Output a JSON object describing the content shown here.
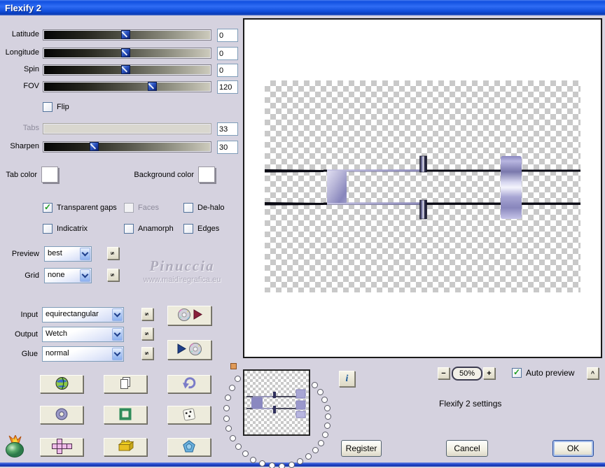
{
  "window": {
    "title": "Flexify 2"
  },
  "sliders": {
    "latitude": {
      "label": "Latitude",
      "value": "0",
      "position_pct": 49
    },
    "longitude": {
      "label": "Longitude",
      "value": "0",
      "position_pct": 49
    },
    "spin": {
      "label": "Spin",
      "value": "0",
      "position_pct": 49
    },
    "fov": {
      "label": "FOV",
      "value": "120",
      "position_pct": 65
    },
    "tabs": {
      "label": "Tabs",
      "value": "33",
      "disabled": true
    },
    "sharpen": {
      "label": "Sharpen",
      "value": "30",
      "position_pct": 30
    }
  },
  "checkboxes": {
    "flip": {
      "label": "Flip",
      "checked": false
    },
    "transparent_gaps": {
      "label": "Transparent gaps",
      "checked": true
    },
    "faces": {
      "label": "Faces",
      "checked": false,
      "disabled": true
    },
    "de_halo": {
      "label": "De-halo",
      "checked": false
    },
    "indicatrix": {
      "label": "Indicatrix",
      "checked": false
    },
    "anamorph": {
      "label": "Anamorph",
      "checked": false
    },
    "edges": {
      "label": "Edges",
      "checked": false
    },
    "auto_preview": {
      "label": "Auto preview",
      "checked": true
    }
  },
  "colors": {
    "tab_color": {
      "label": "Tab color",
      "value": "#ffffff"
    },
    "background_color": {
      "label": "Background color",
      "value": "#ffffff"
    }
  },
  "dropdowns": {
    "preview": {
      "label": "Preview",
      "value": "best"
    },
    "grid": {
      "label": "Grid",
      "value": "none"
    },
    "input": {
      "label": "Input",
      "value": "equirectangular"
    },
    "output": {
      "label": "Output",
      "value": "Wetch"
    },
    "glue": {
      "label": "Glue",
      "value": "normal"
    }
  },
  "s_button_label": "s",
  "watermark": {
    "line1": "Pinuccia",
    "line2": "www.maidiregrafica.eu"
  },
  "zoom_controls": {
    "minus": "−",
    "level": "50%",
    "plus": "+",
    "collapse": "^"
  },
  "status": {
    "settings_text": "Flexify 2 settings"
  },
  "buttons": {
    "register": "Register",
    "cancel": "Cancel",
    "ok": "OK",
    "info": "i"
  },
  "icons": {
    "grid_buttons": [
      "globe-icon",
      "copy-icon",
      "undo-icon",
      "ring-icon",
      "frame-icon",
      "dice-icon",
      "unfolded-cube-icon",
      "lego-brick-icon",
      "polyhedron-icon"
    ],
    "disc_load": "disc-red-play-icon",
    "disc_save": "blue-play-disc-icon",
    "logo": "flaming-pear-logo",
    "info": "info-icon"
  },
  "accent_colors": {
    "titlebar_blue": "#1150e0",
    "check_green": "#1e9e1e",
    "input_border": "#7f9db9"
  }
}
